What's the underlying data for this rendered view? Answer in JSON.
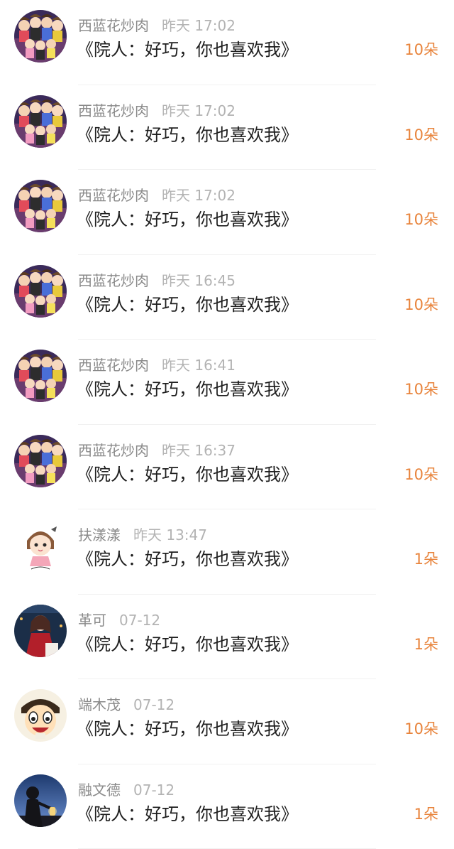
{
  "gift_list": {
    "items": [
      {
        "name": "西蓝花炒肉",
        "time": "昨天 17:02",
        "title": "《院人：好巧，你也喜欢我》",
        "count": "10朵",
        "avatar_icon": "group-cartoon-avatar-icon"
      },
      {
        "name": "西蓝花炒肉",
        "time": "昨天 17:02",
        "title": "《院人：好巧，你也喜欢我》",
        "count": "10朵",
        "avatar_icon": "group-cartoon-avatar-icon"
      },
      {
        "name": "西蓝花炒肉",
        "time": "昨天 17:02",
        "title": "《院人：好巧，你也喜欢我》",
        "count": "10朵",
        "avatar_icon": "group-cartoon-avatar-icon"
      },
      {
        "name": "西蓝花炒肉",
        "time": "昨天 16:45",
        "title": "《院人：好巧，你也喜欢我》",
        "count": "10朵",
        "avatar_icon": "group-cartoon-avatar-icon"
      },
      {
        "name": "西蓝花炒肉",
        "time": "昨天 16:41",
        "title": "《院人：好巧，你也喜欢我》",
        "count": "10朵",
        "avatar_icon": "group-cartoon-avatar-icon"
      },
      {
        "name": "西蓝花炒肉",
        "time": "昨天 16:37",
        "title": "《院人：好巧，你也喜欢我》",
        "count": "10朵",
        "avatar_icon": "group-cartoon-avatar-icon"
      },
      {
        "name": "扶漾漾",
        "time": "昨天 13:47",
        "title": "《院人：好巧，你也喜欢我》",
        "count": "1朵",
        "avatar_icon": "chibi-girl-avatar-icon"
      },
      {
        "name": "革可",
        "time": "07-12",
        "title": "《院人：好巧，你也喜欢我》",
        "count": "1朵",
        "avatar_icon": "anime-girl-red-dress-avatar-icon"
      },
      {
        "name": "端木茂",
        "time": "07-12",
        "title": "《院人：好巧，你也喜欢我》",
        "count": "10朵",
        "avatar_icon": "luffy-cartoon-avatar-icon"
      },
      {
        "name": "融文德",
        "time": "07-12",
        "title": "《院人：好巧，你也喜欢我》",
        "count": "1朵",
        "avatar_icon": "silhouette-lantern-avatar-icon"
      }
    ]
  },
  "colors": {
    "name_text": "#8a8a8a",
    "time_text": "#b3b3b3",
    "title_text": "#1e1e1e",
    "count_accent": "#e8843c",
    "divider": "#f1f1f1"
  }
}
